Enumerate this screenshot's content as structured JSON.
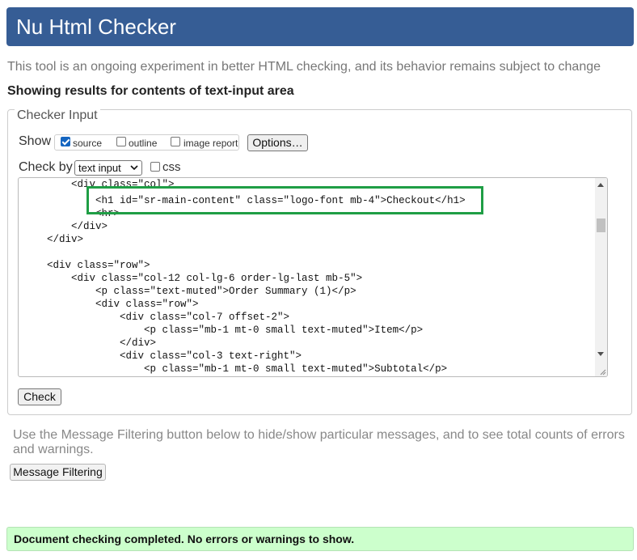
{
  "header": {
    "title": "Nu Html Checker"
  },
  "tagline": "This tool is an ongoing experiment in better HTML checking, and its behavior remains subject to change",
  "showing": "Showing results for contents of text-input area",
  "checker_input": {
    "legend": "Checker Input",
    "show_label": "Show",
    "options": [
      {
        "label": "source",
        "checked": true
      },
      {
        "label": "outline",
        "checked": false
      },
      {
        "label": "image report",
        "checked": false
      }
    ],
    "options_button": "Options…",
    "check_by_label": "Check by",
    "check_by_selected": "text input",
    "css_label": "css",
    "css_checked": false,
    "check_button": "Check"
  },
  "source_lines": [
    "        <div class=\"col\">",
    "            <h1 id=\"sr-main-content\" class=\"logo-font mb-4\">Checkout</h1>",
    "            <hr>",
    "        </div>",
    "    </div>",
    "",
    "    <div class=\"row\">",
    "        <div class=\"col-12 col-lg-6 order-lg-last mb-5\">",
    "            <p class=\"text-muted\">Order Summary (1)</p>",
    "            <div class=\"row\">",
    "                <div class=\"col-7 offset-2\">",
    "                    <p class=\"mb-1 mt-0 small text-muted\">Item</p>",
    "                </div>",
    "                <div class=\"col-3 text-right\">",
    "                    <p class=\"mb-1 mt-0 small text-muted\">Subtotal</p>"
  ],
  "filtering": {
    "text": "Use the Message Filtering button below to hide/show particular messages, and to see total counts of errors and warnings.",
    "button": "Message Filtering"
  },
  "status": "Document checking completed. No errors or warnings to show.",
  "colors": {
    "header_bg": "#365d95",
    "status_bg": "#ccffcc",
    "highlight": "#1f9e45"
  }
}
